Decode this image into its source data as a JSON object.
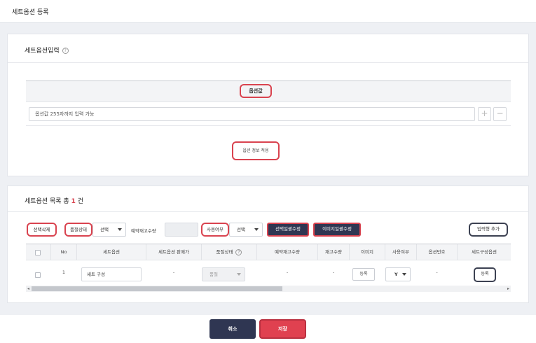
{
  "page": {
    "title": "세트옵션 등록"
  },
  "input_panel": {
    "title": "세트옵션입력",
    "help": "?",
    "column_header": "옵션값",
    "option_placeholder": "옵션값 255자까지 입력 가능",
    "add_symbol": "+",
    "remove_symbol": "−",
    "apply_label": "옵션 정보 적용"
  },
  "list_panel": {
    "title_prefix": "세트옵션 목록 총",
    "count": "1",
    "title_suffix": "건",
    "toolbar": {
      "delete_selected": "선택삭제",
      "soldout_label": "품절상태",
      "soldout_select": "선택",
      "reserve_stock_label": "예약재고수량",
      "use_label": "사용여부",
      "use_select": "선택",
      "bulk_edit_selected": "선택일괄수정",
      "bulk_edit_image": "이미지일괄수정",
      "add_input_item": "입력형 추가"
    },
    "columns": [
      "No",
      "세트옵션",
      "세트옵션 판매가",
      "품절상태",
      "예약재고수량",
      "재고수량",
      "이미지",
      "사용여부",
      "옵션번호",
      "세트구성옵션"
    ],
    "soldout_help": "?",
    "rows": [
      {
        "no": "1",
        "set_option": "세트 구성",
        "price": "-",
        "soldout": "품절",
        "reserve_stock": "-",
        "stock": "-",
        "image_btn": "등록",
        "use": "Y",
        "option_no": "-",
        "composition_btn": "등록"
      }
    ],
    "scroll_left": "◂",
    "scroll_right": "▸"
  },
  "footer": {
    "cancel": "취소",
    "save": "저장"
  },
  "colors": {
    "accent_red": "#d9434f",
    "navy": "#2f3652",
    "save_red": "#e04150"
  }
}
